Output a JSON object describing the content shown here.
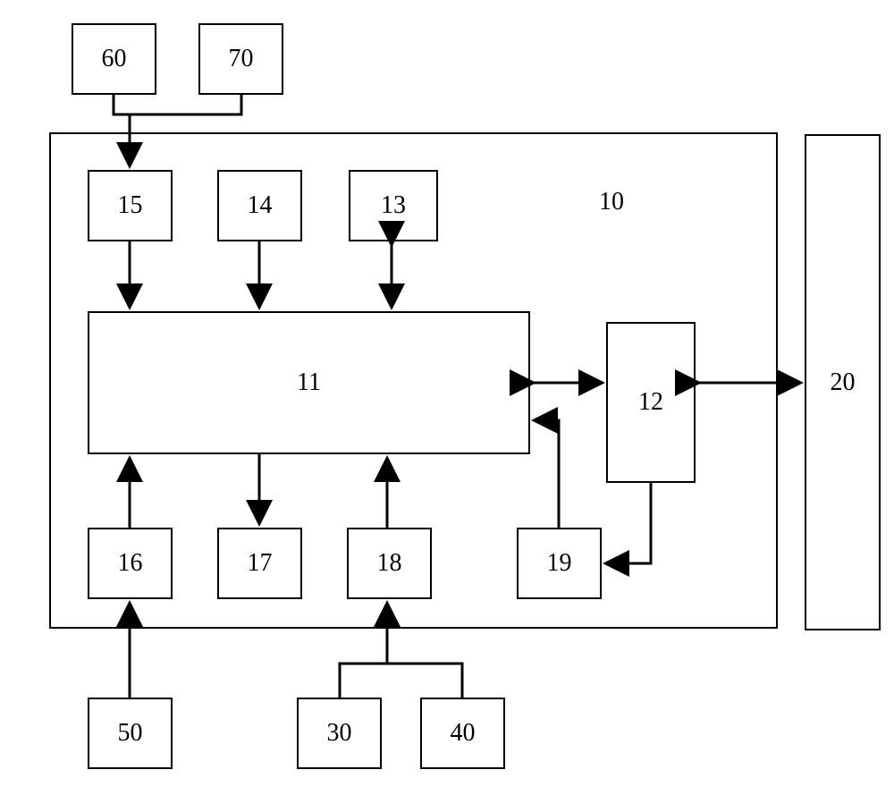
{
  "blocks": {
    "b60": "60",
    "b70": "70",
    "b15": "15",
    "b14": "14",
    "b13": "13",
    "b10": "10",
    "b11": "11",
    "b12": "12",
    "b20": "20",
    "b16": "16",
    "b17": "17",
    "b18": "18",
    "b19": "19",
    "b50": "50",
    "b30": "30",
    "b40": "40"
  }
}
